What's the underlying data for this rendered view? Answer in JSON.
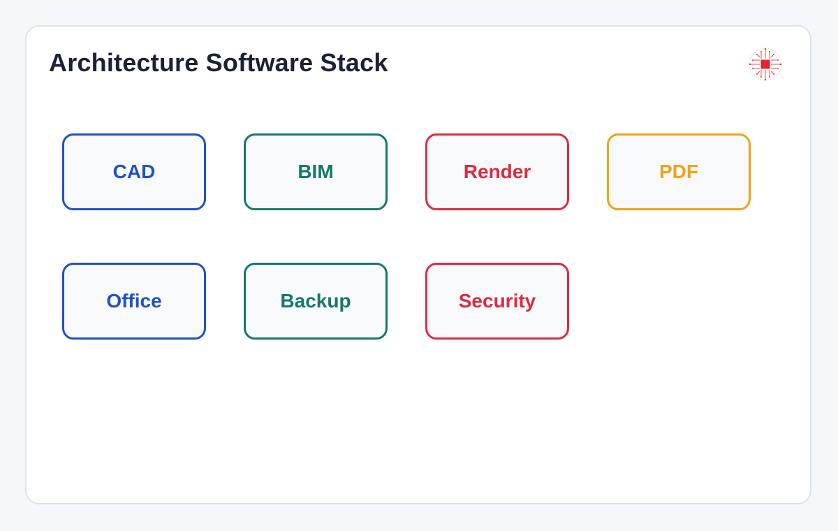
{
  "header": {
    "title": "Architecture Software Stack",
    "logo_icon": "circuit-chip-icon"
  },
  "tiles": [
    {
      "label": "CAD",
      "color": "#2150c6"
    },
    {
      "label": "BIM",
      "color": "#15786a"
    },
    {
      "label": "Render",
      "color": "#dc2b40"
    },
    {
      "label": "PDF",
      "color": "#eea21a"
    },
    {
      "label": "Office",
      "color": "#2150c6"
    },
    {
      "label": "Backup",
      "color": "#15786a"
    },
    {
      "label": "Security",
      "color": "#dc2b40"
    }
  ],
  "colors": {
    "background": "#f5f7fa",
    "card": "#ffffff",
    "title": "#1a2238"
  }
}
